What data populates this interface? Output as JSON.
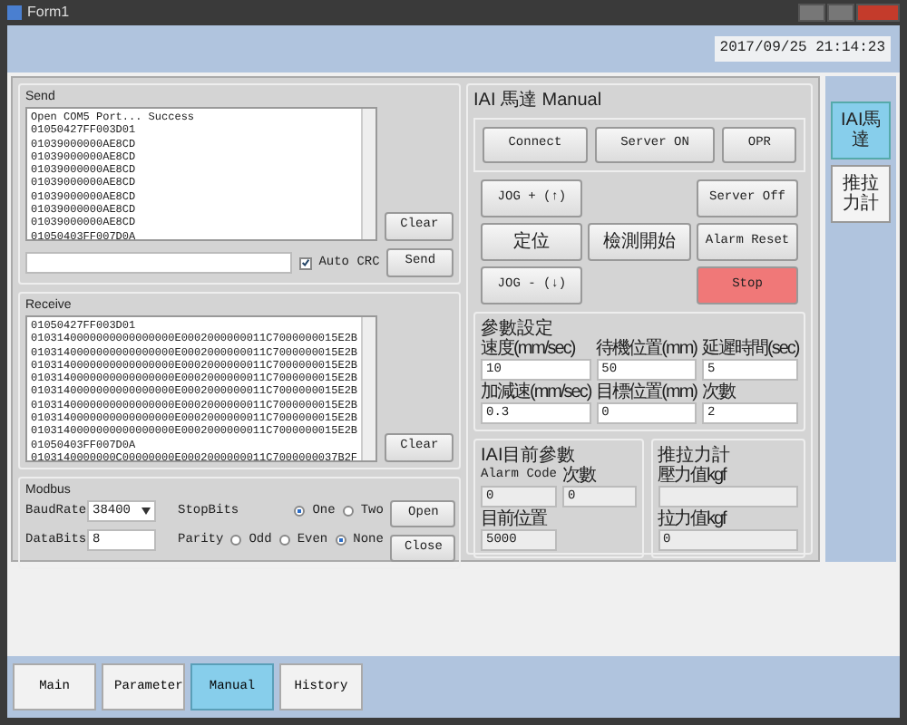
{
  "window": {
    "title": "Form1"
  },
  "header": {
    "clock": "2017/09/25 21:14:23"
  },
  "send": {
    "title": "Send",
    "log": [
      "Open COM5 Port... Success",
      "01050427FF003D01",
      "01039000000AE8CD",
      "01039000000AE8CD",
      "01039000000AE8CD",
      "01039000000AE8CD",
      "01039000000AE8CD",
      "01039000000AE8CD",
      "01039000000AE8CD",
      "01050403FF007D0A"
    ],
    "auto_crc": {
      "label": "Auto CRC",
      "checked": true
    },
    "clear": "Clear",
    "send": "Send"
  },
  "receive": {
    "title": "Receive",
    "log": [
      "01050427FF003D01",
      "0103140000000000000000E0002000000011C7000000015E2B",
      "0103140000000000000000E0002000000011C7000000015E2B",
      "0103140000000000000000E0002000000011C7000000015E2B",
      "0103140000000000000000E0002000000011C7000000015E2B",
      "0103140000000000000000E0002000000011C7000000015E2B",
      "0103140000000000000000E0002000000011C7000000015E2B",
      "0103140000000000000000E0002000000011C7000000015E2B",
      "0103140000000000000000E0002000000011C7000000015E2B",
      "01050403FF007D0A",
      "0103140000000C00000000E0002000000011C7000000037B2F"
    ],
    "clear": "Clear"
  },
  "modbus": {
    "title": "Modbus",
    "baud_label": "BaudRate",
    "baud_value": "38400",
    "stopbits_label": "StopBits",
    "stopbits": [
      {
        "label": "One",
        "selected": true
      },
      {
        "label": "Two",
        "selected": false
      }
    ],
    "databits_label": "DataBits",
    "databits_value": "8",
    "parity_label": "Parity",
    "parity": [
      {
        "label": "Odd",
        "selected": false
      },
      {
        "label": "Even",
        "selected": false
      },
      {
        "label": "None",
        "selected": true
      }
    ],
    "open": "Open",
    "close": "Close"
  },
  "manual": {
    "title": "IAI 馬達 Manual",
    "top_buttons": [
      "Connect",
      "Server ON",
      "OPR"
    ],
    "grid": [
      {
        "kind": "button",
        "label": "JOG + (↑)"
      },
      {
        "kind": "empty"
      },
      {
        "kind": "button",
        "label": "Server Off"
      },
      {
        "kind": "button",
        "label": "定位"
      },
      {
        "kind": "button",
        "label": "檢測開始"
      },
      {
        "kind": "button",
        "label": "Alarm Reset"
      },
      {
        "kind": "button",
        "label": "JOG - (↓)"
      },
      {
        "kind": "empty"
      },
      {
        "kind": "stop",
        "label": "Stop"
      }
    ],
    "params": {
      "title": "參數設定",
      "fields": [
        {
          "label": "速度(mm/sec)",
          "value": "10"
        },
        {
          "label": "待機位置(mm)",
          "value": "50"
        },
        {
          "label": "延遲時間(sec)",
          "value": "5"
        },
        {
          "label": "加減速(mm/sec)",
          "value": "0.3"
        },
        {
          "label": "目標位置(mm)",
          "value": "0"
        },
        {
          "label": "次數",
          "value": "2"
        }
      ]
    },
    "current": {
      "title": "IAI目前參數",
      "fields": [
        {
          "label": "Alarm Code",
          "value": "0"
        },
        {
          "label": "次數",
          "value": "0"
        },
        {
          "label": "目前位置",
          "value": "5000"
        }
      ]
    },
    "force": {
      "title": "推拉力計",
      "fields": [
        {
          "label": "壓力值kgf"
        },
        {
          "label": "拉力值kgf",
          "value": "0"
        }
      ]
    }
  },
  "side_tabs": [
    {
      "label": "IAI馬達",
      "selected": true
    },
    {
      "label": "推拉力計",
      "selected": false
    }
  ],
  "bottom_tabs": [
    {
      "label": "Main",
      "selected": false
    },
    {
      "label": "Parameter",
      "selected": false
    },
    {
      "label": "Manual",
      "selected": true
    },
    {
      "label": "History",
      "selected": false
    }
  ]
}
